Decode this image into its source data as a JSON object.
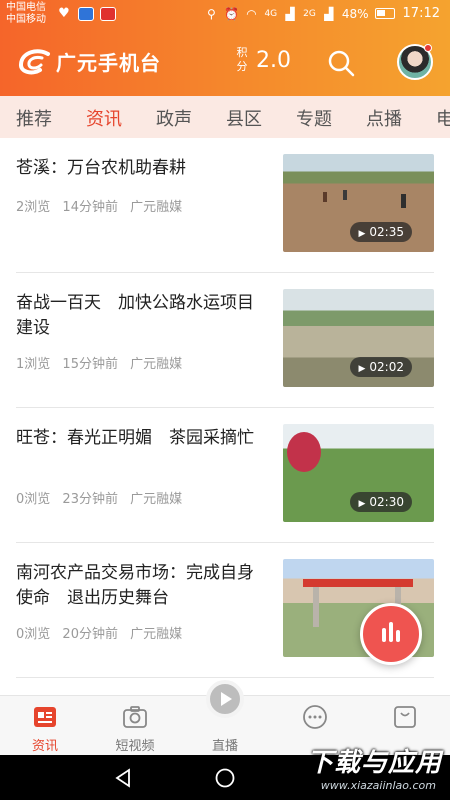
{
  "statusbar": {
    "carrier_1": "中国电信",
    "carrier_2": "中国移动",
    "network_1": "4G",
    "network_2": "2G",
    "battery": "48%",
    "time": "17:12"
  },
  "header": {
    "app_name": "广元手机台",
    "points_label": "积分",
    "points_value": "2.0",
    "accent_color": "#f5652a"
  },
  "tabs": [
    {
      "label": "推荐"
    },
    {
      "label": "资讯"
    },
    {
      "label": "政声"
    },
    {
      "label": "县区"
    },
    {
      "label": "专题"
    },
    {
      "label": "点播"
    },
    {
      "label": "电"
    }
  ],
  "active_tab": "资讯",
  "news": [
    {
      "title": "苍溪：万台农机助春耕",
      "views": "2浏览",
      "time": "14分钟前",
      "source": "广元融媒",
      "duration": "02:35"
    },
    {
      "title": "奋战一百天　加快公路水运项目建设",
      "views": "1浏览",
      "time": "15分钟前",
      "source": "广元融媒",
      "duration": "02:02"
    },
    {
      "title": "旺苍：春光正明媚　茶园采摘忙",
      "views": "0浏览",
      "time": "23分钟前",
      "source": "广元融媒",
      "duration": "02:30"
    },
    {
      "title": "南河农产品交易市场：完成自身使命　退出历史舞台",
      "views": "0浏览",
      "time": "20分钟前",
      "source": "广元融媒",
      "duration": ""
    }
  ],
  "bottom_nav": [
    {
      "label": "资讯",
      "icon": "news-icon"
    },
    {
      "label": "短视频",
      "icon": "camera-icon"
    },
    {
      "label": "直播",
      "icon": "play-icon"
    },
    {
      "label": "",
      "icon": "chat-icon"
    },
    {
      "label": "",
      "icon": "bag-icon"
    }
  ],
  "watermark": {
    "text": "下载与应用",
    "url": "www.xiazaiinlao.com"
  }
}
